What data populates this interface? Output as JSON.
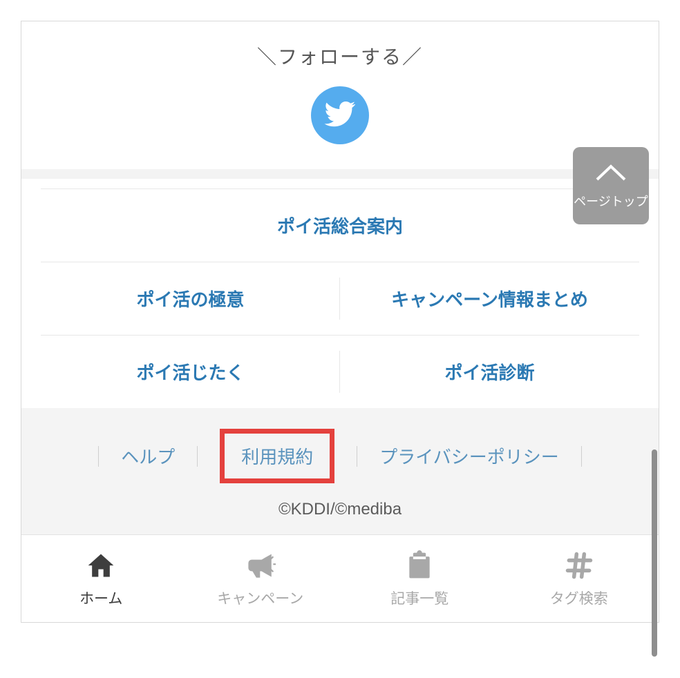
{
  "follow": {
    "label": "＼フォローする／"
  },
  "pagetop": {
    "label": "ページトップ"
  },
  "category_links": {
    "main": "ポイ活総合案内",
    "row2": [
      "ポイ活の極意",
      "キャンペーン情報まとめ"
    ],
    "row3": [
      "ポイ活じたく",
      "ポイ活診断"
    ]
  },
  "footer_links": {
    "help": "ヘルプ",
    "terms": "利用規約",
    "privacy": "プライバシーポリシー"
  },
  "copyright": "©KDDI/©mediba",
  "bottom_nav": [
    {
      "label": "ホーム",
      "active": true
    },
    {
      "label": "キャンペーン",
      "active": false
    },
    {
      "label": "記事一覧",
      "active": false
    },
    {
      "label": "タグ検索",
      "active": false
    }
  ]
}
